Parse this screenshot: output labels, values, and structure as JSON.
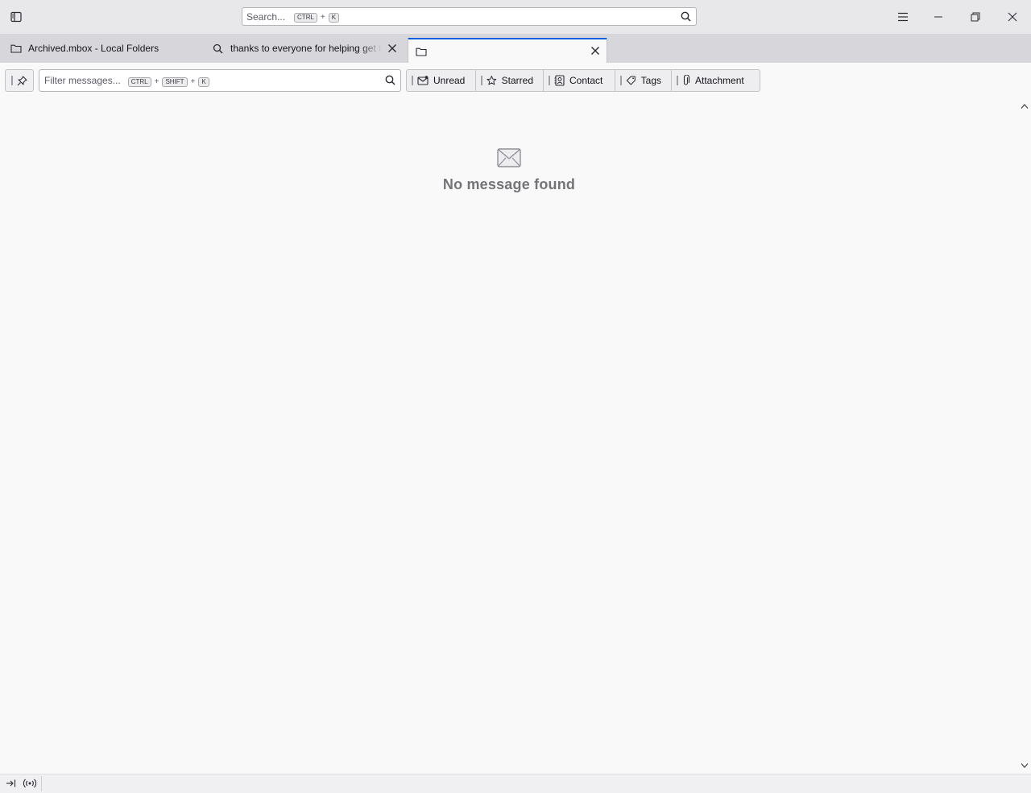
{
  "titlebar": {
    "search": {
      "placeholder": "Search...",
      "shortcut": [
        "CTRL",
        "K"
      ],
      "plus": "+"
    }
  },
  "tabs": [
    {
      "label": "Archived.mbox - Local Folders",
      "icon": "folder-icon"
    },
    {
      "label": "thanks to everyone for helping get t",
      "icon": "search-icon"
    },
    {
      "label": "",
      "icon": "folder-icon"
    }
  ],
  "quickfilter": {
    "filter": {
      "placeholder": "Filter messages...",
      "shortcut": [
        "CTRL",
        "SHIFT",
        "K"
      ],
      "plus": "+"
    },
    "buttons": [
      {
        "label": "Unread",
        "icon": "unread-envelope-icon"
      },
      {
        "label": "Starred",
        "icon": "star-icon"
      },
      {
        "label": "Contact",
        "icon": "contact-icon"
      },
      {
        "label": "Tags",
        "icon": "tag-icon"
      },
      {
        "label": "Attachment",
        "icon": "paperclip-icon"
      }
    ]
  },
  "main": {
    "empty_message": "No message found",
    "empty_icon": "envelope-icon"
  },
  "colors": {
    "accent": "#0060df",
    "background": "#f9f9fa",
    "titlebar": "#e8e8ea",
    "tabbar": "#d7d7db"
  }
}
